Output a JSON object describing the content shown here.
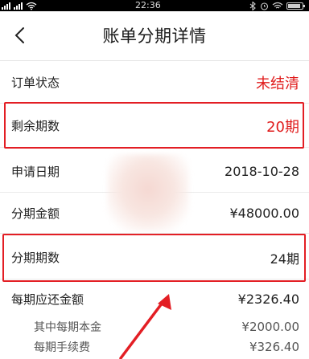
{
  "status_bar": {
    "time": "22:36"
  },
  "nav": {
    "title": "账单分期详情",
    "back_icon": "chevron-left-icon"
  },
  "rows": [
    {
      "label": "订单状态",
      "value": "未结清",
      "highlight": false,
      "value_color": "#e01c1c"
    },
    {
      "label": "剩余期数",
      "value": "20期",
      "highlight": true,
      "value_color": "#e01c1c"
    },
    {
      "label": "申请日期",
      "value": "2018-10-28",
      "highlight": false
    },
    {
      "label": "分期金额",
      "value": "¥48000.00",
      "highlight": false
    },
    {
      "label": "分期期数",
      "value": "24期",
      "highlight": true
    },
    {
      "label": "每期应还金额",
      "value": "¥2326.40",
      "highlight": false
    }
  ],
  "sub_rows": [
    {
      "label": "其中每期本金",
      "value": "¥2000.00"
    },
    {
      "label": "每期手续费",
      "value": "¥326.40"
    }
  ],
  "colors": {
    "accent_red": "#e31e24",
    "text": "#222222",
    "divider": "#ececec"
  }
}
